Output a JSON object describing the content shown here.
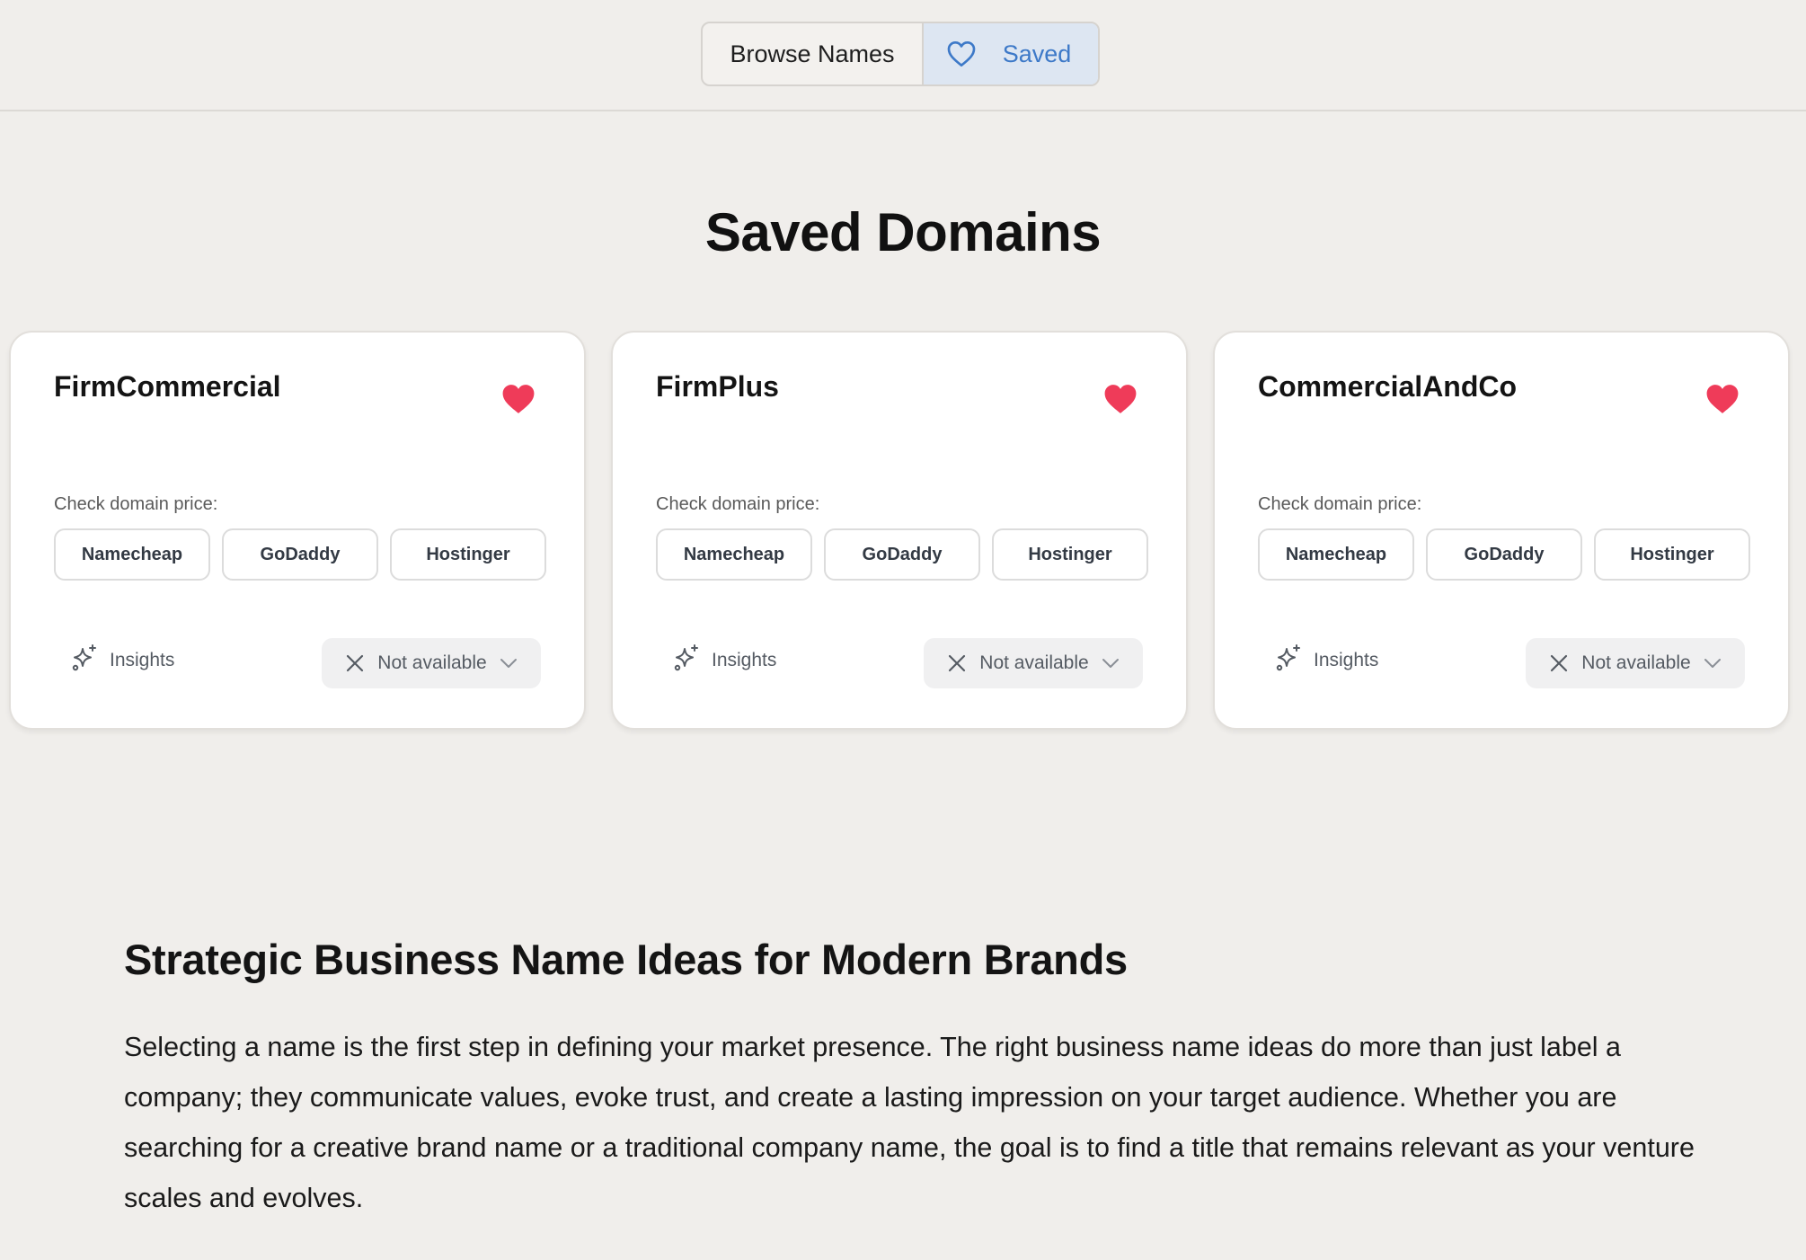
{
  "nav": {
    "browse_label": "Browse Names",
    "saved_label": "Saved"
  },
  "page_title": "Saved Domains",
  "colors": {
    "heart": "#ef3b59",
    "accent": "#3d79c8",
    "saved_bg": "#dde6f2"
  },
  "cards": [
    {
      "name": "FirmCommercial",
      "price_label": "Check domain price:",
      "registrars": [
        "Namecheap",
        "GoDaddy",
        "Hostinger"
      ],
      "insights_label": "Insights",
      "status_label": "Not available"
    },
    {
      "name": "FirmPlus",
      "price_label": "Check domain price:",
      "registrars": [
        "Namecheap",
        "GoDaddy",
        "Hostinger"
      ],
      "insights_label": "Insights",
      "status_label": "Not available"
    },
    {
      "name": "CommercialAndCo",
      "price_label": "Check domain price:",
      "registrars": [
        "Namecheap",
        "GoDaddy",
        "Hostinger"
      ],
      "insights_label": "Insights",
      "status_label": "Not available"
    }
  ],
  "article": {
    "heading": "Strategic Business Name Ideas for Modern Brands",
    "body": "Selecting a name is the first step in defining your market presence. The right business name ideas do more than just label a company; they communicate values, evoke trust, and create a lasting impression on your target audience. Whether you are searching for a creative brand name or a traditional company name, the goal is to find a title that remains relevant as your venture scales and evolves."
  }
}
